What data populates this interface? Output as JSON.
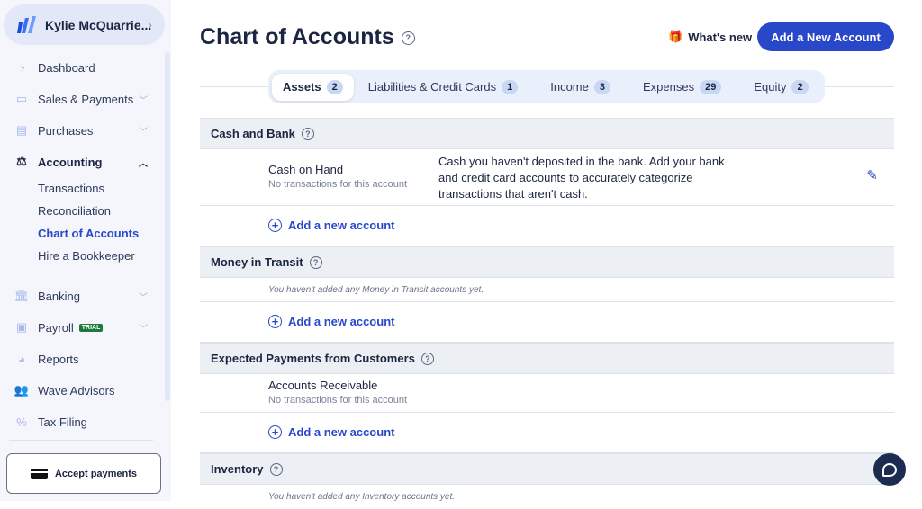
{
  "sidebar": {
    "business_name": "Kylie McQuarrie...",
    "items": [
      {
        "label": "Dashboard",
        "icon": "dashboard-icon"
      },
      {
        "label": "Sales & Payments",
        "icon": "card-icon"
      },
      {
        "label": "Purchases",
        "icon": "receipt-icon"
      },
      {
        "label": "Accounting",
        "icon": "scale-icon"
      },
      {
        "label": "Banking",
        "icon": "bank-icon"
      },
      {
        "label": "Payroll",
        "icon": "badge-icon",
        "badge": "TRIAL"
      },
      {
        "label": "Reports",
        "icon": "pie-icon"
      },
      {
        "label": "Wave Advisors",
        "icon": "people-icon"
      },
      {
        "label": "Tax Filing",
        "icon": "percent-icon"
      }
    ],
    "accounting_sub": [
      "Transactions",
      "Reconciliation",
      "Chart of Accounts",
      "Hire a Bookkeeper"
    ],
    "accept_payments": "Accept payments"
  },
  "header": {
    "title": "Chart of Accounts",
    "whats_new": "What's new",
    "add_button": "Add a New Account"
  },
  "tabs": [
    {
      "label": "Assets",
      "count": "2"
    },
    {
      "label": "Liabilities & Credit Cards",
      "count": "1"
    },
    {
      "label": "Income",
      "count": "3"
    },
    {
      "label": "Expenses",
      "count": "29"
    },
    {
      "label": "Equity",
      "count": "2"
    }
  ],
  "sections": [
    {
      "title": "Cash and Bank",
      "account": "Cash on Hand",
      "account_sub": "No transactions for this account",
      "description": "Cash you haven't deposited in the bank. Add your bank and credit card accounts to accurately categorize transactions that aren't cash.",
      "add": "Add a new account"
    },
    {
      "title": "Money in Transit",
      "empty": "You haven't added any Money in Transit accounts yet.",
      "add": "Add a new account"
    },
    {
      "title": "Expected Payments from Customers",
      "account": "Accounts Receivable",
      "account_sub": "No transactions for this account",
      "add": "Add a new account"
    },
    {
      "title": "Inventory",
      "empty": "You haven't added any Inventory accounts yet."
    }
  ],
  "colors": {
    "accent": "#2948c9",
    "sidebar_bg": "#f4f6fc",
    "section_bg": "#eceff3"
  }
}
